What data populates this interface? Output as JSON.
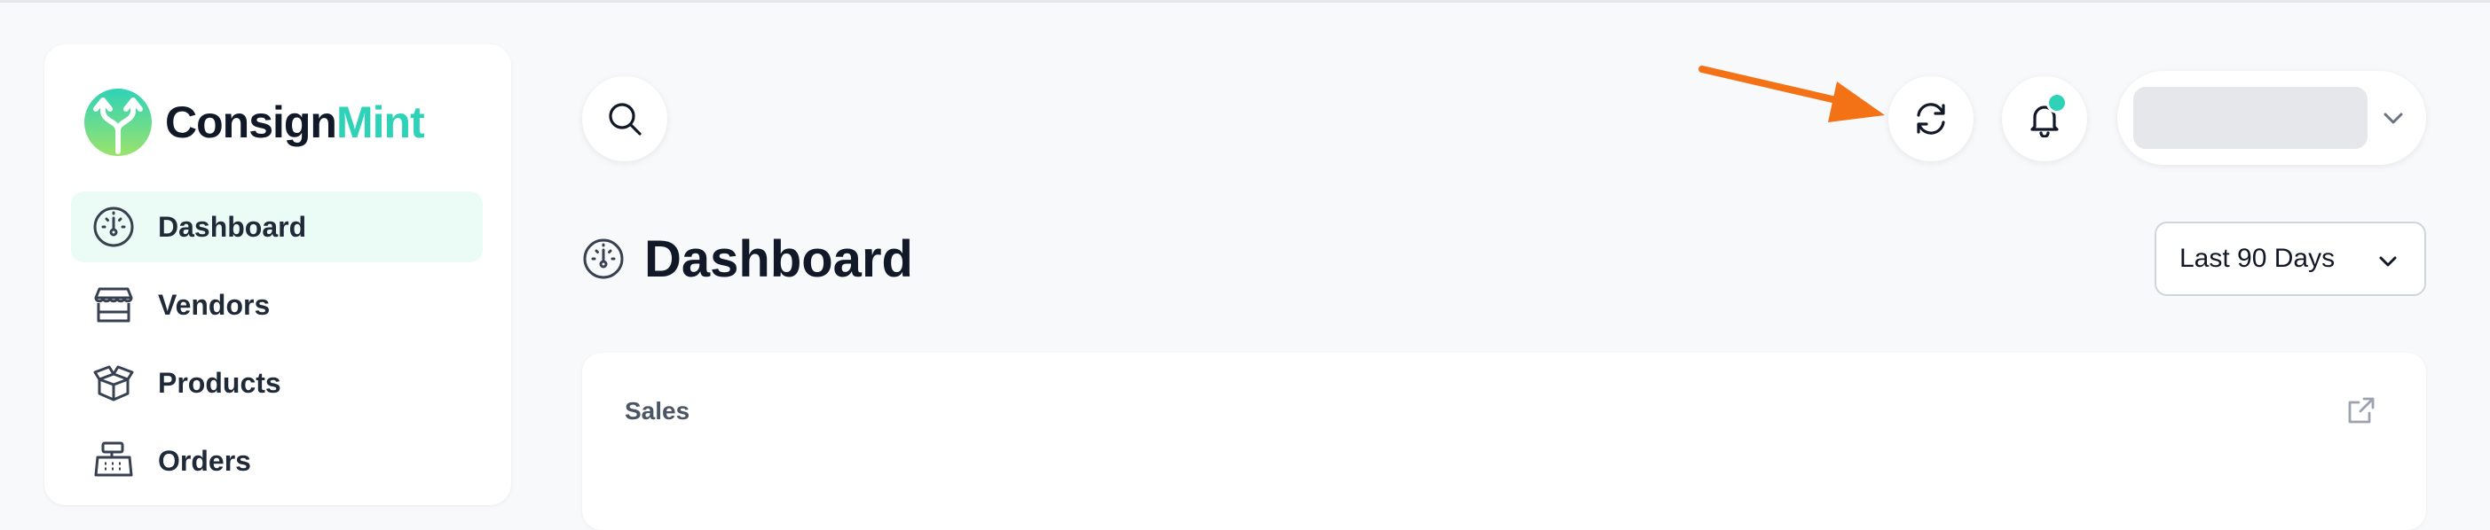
{
  "brand": {
    "name_part1": "Consign",
    "name_part2": "Mint",
    "accent_color": "#2ed3b7",
    "logo_icon": "split-arrows-logo-icon"
  },
  "sidebar": {
    "items": [
      {
        "label": "Dashboard",
        "icon": "gauge-icon",
        "active": true
      },
      {
        "label": "Vendors",
        "icon": "storefront-icon",
        "active": false
      },
      {
        "label": "Products",
        "icon": "box-icon",
        "active": false
      },
      {
        "label": "Orders",
        "icon": "cash-register-icon",
        "active": false
      }
    ]
  },
  "header": {
    "search_icon": "search-icon",
    "refresh_icon": "refresh-icon",
    "notification_icon": "bell-icon",
    "notification_dot_color": "#2ed3b7",
    "user_menu_icon": "chevron-down-icon"
  },
  "main": {
    "title": "Dashboard",
    "title_icon": "gauge-icon",
    "date_range": {
      "selected": "Last 90 Days",
      "icon": "chevron-down-icon"
    },
    "card": {
      "title": "Sales",
      "icon": "external-link-icon"
    }
  },
  "annotation": {
    "color": "#f47216",
    "icon": "arrow-icon"
  }
}
